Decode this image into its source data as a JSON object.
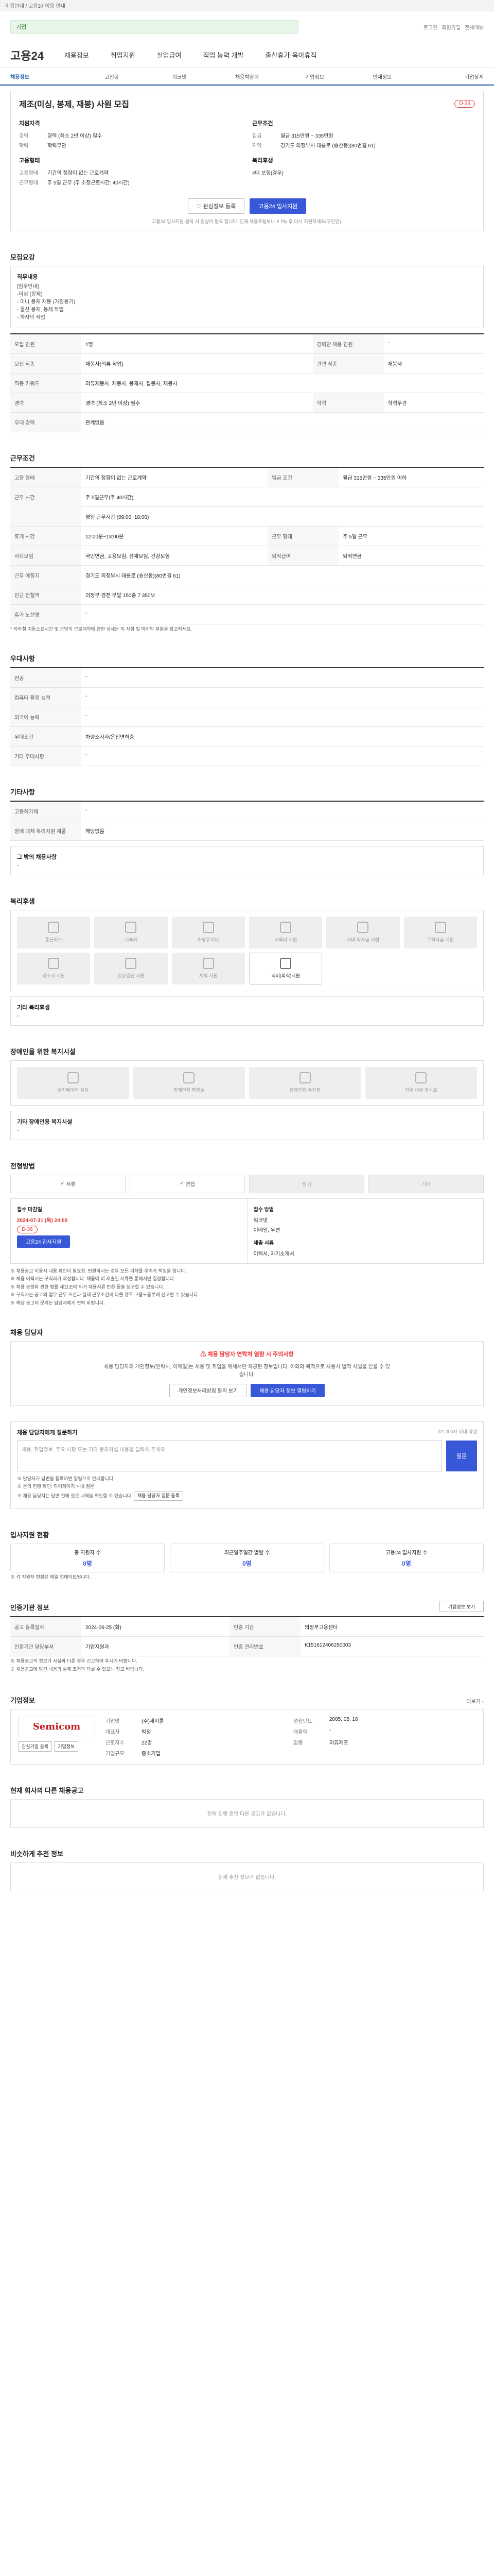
{
  "topbar": {
    "notice": "이용안내 / 고용24 이용 안내"
  },
  "search": {
    "value": "기업"
  },
  "util": [
    "로그인",
    "회원가입",
    "전체메뉴"
  ],
  "logo": "고용24",
  "gnb": [
    "채용정보",
    "취업지원",
    "실업급여",
    "직업 능력 개발",
    "출산휴가·육아휴직"
  ],
  "subnav": [
    "채용정보",
    "고진공",
    "워크넷",
    "채용박람회",
    "기업정보",
    "인재정보",
    "기업상세"
  ],
  "hero": {
    "title": "제조(미싱, 봉제, 재봉) 사원 모집",
    "dday": "D-36",
    "left_title": "지원자격",
    "right_title": "근무조건",
    "left": [
      {
        "k": "경력",
        "v": "경력 (최소 2년 이상) 필수"
      },
      {
        "k": "학력",
        "v": "학력무관"
      }
    ],
    "right": [
      {
        "k": "임금",
        "v": "월급 315만원 ~ 335만원"
      },
      {
        "k": "지역",
        "v": "경기도 의정부시 태릉로 (송산동)(80번길 61)"
      }
    ],
    "left2_title": "고용형태",
    "left2": [
      {
        "k": "고용형태",
        "v": "기간의 정함이 없는 근로계약"
      },
      {
        "k": "근무형태",
        "v": "주 5일 근무 (주 소정근로시간: 40시간)"
      }
    ],
    "right2_title": "복리후생",
    "right2": [
      {
        "k": "",
        "v": "4대 보험(경우)"
      }
    ],
    "btn_scrap": "관심정보 등록",
    "btn_apply": "고용24 입사지원",
    "note": "고용24 입사지원 클릭 시 원상이 필요 합니다. 인재 채용포털보나 X Pix 후 이시 지원하세요(구인인)."
  },
  "s_recruit": {
    "title": "모집요강",
    "duty_label": "직무내용",
    "duty": [
      "[임무안내]",
      "-미싱 (봉제)",
      "- 미니 봉재 재봉 (가정용기)",
      "- 물산 봉제, 봉제 작업",
      "- 하자의 직업"
    ],
    "rows": [
      [
        "모집 인원",
        "1명",
        "경력단 채용 인원",
        "-"
      ],
      [
        "모집 직종",
        "재봉사(의류 작업)",
        "관련 직종",
        "재봉사"
      ],
      [
        "직종 키워드",
        "의류재봉사, 재봉사, 봉제사, 절봉사, 재봉사",
        "",
        ""
      ],
      [
        "경력",
        "경력 (최소 2년 이상) 필수",
        "학력",
        "학력무관"
      ],
      [
        "우대 경력",
        "관계없음",
        "",
        ""
      ]
    ]
  },
  "s_cond": {
    "title": "근무조건",
    "rows": [
      [
        "고용 형태",
        "기간의 정함이 없는 근로계약",
        "임금 조건",
        "월급 315만원 ~ 335만원 이하"
      ],
      [
        "근무 시간",
        "주 5일근무(주 40시간)",
        "",
        ""
      ],
      [
        "근무 형태",
        "평일 근무시간 (09:00~18:00)",
        "",
        ""
      ],
      [
        "휴게 시간",
        "12:00분~13:00분",
        "근무 형태",
        "주 5일 근무"
      ],
      [
        "사회보험",
        "국민연금, 고용보험, 산재보험, 건강보험",
        "퇴직급여",
        "퇴직연금"
      ],
      [
        "근무 예정지",
        "경기도 의정부시 태릉로 (송산동)(80번길 61)",
        "",
        ""
      ],
      [
        "인근 전철역",
        "의정부 경전 부발 150종 7 350M",
        "",
        ""
      ],
      [
        "휴가 노선명",
        "-",
        "",
        ""
      ]
    ],
    "note": "* 지하철 이동소요시간 및 근방이 근로계약에 관한 상세는 지 사항 및 마지막 부분을 참고하세요."
  },
  "s_prefer": {
    "title": "우대사항",
    "rows": [
      [
        "전공",
        "-"
      ],
      [
        "컴퓨터 활용 능력",
        "-"
      ],
      [
        "외국어 능력",
        "-"
      ],
      [
        "우대조건",
        "차량소지자/운전면허증"
      ],
      [
        "기타 우대사항",
        "-"
      ]
    ]
  },
  "s_other": {
    "title": "기타사항",
    "rows": [
      [
        "고용허가제",
        "-"
      ],
      [
        "장애 대체 복리지원 제품",
        "해당없음"
      ]
    ],
    "sub_title": "그 밖의 채용사항",
    "sub_value": "-"
  },
  "s_benefit": {
    "title": "복리후생",
    "items": [
      "통근버스",
      "기숙사",
      "차량유지비",
      "교육비 지원",
      "자녀 학자금 지원",
      "주택자금 지원",
      "경조사 지원",
      "건강검진 지원",
      "체력 지원",
      "식비(회식)지원"
    ],
    "on_index": 9,
    "other_label": "기타 복리후생",
    "other_value": "-"
  },
  "s_disability": {
    "title": "장애인을 위한 복지시설",
    "items": [
      "엘리베이터 설치",
      "장애인용 화장실",
      "장애인용 주차장",
      "건물 내부 경사로"
    ],
    "other_label": "기타 장애인용 복지시설",
    "other_value": "-"
  },
  "s_process": {
    "title": "전형방법",
    "tabs": [
      "서류",
      "면접",
      "필기",
      "기타"
    ],
    "active_tabs": [
      0,
      1
    ],
    "deadline_label": "접수 마감일",
    "deadline": "2024-07-31 (목) 24:00",
    "dday": "D-36",
    "apply_btn": "고용24 입사지원",
    "method_label": "접수 방법",
    "method": "워크넷",
    "method_sub": "이메일, 우편",
    "docs_label": "제출 서류",
    "docs": "이력서, 자기소개서"
  },
  "s_process_notes": [
    "※ 채용공고 이용시 내용 확인이 필요함. 반환하시는 경우 모든 피해를 우리가 책임을 집니다.",
    "※ 채용 이력서는 구직자가 작성합니다. 채용에 미 제출된 서류를 통해서만 결정합니다.",
    "※ 채용 공정화 관한 법률 제11조에 의거 채용서류 반환 등을 청구할 수 있습니다.",
    "※ 구직자는 공고의 업무 근무 조건과 실제 근무조건이 다를 경우 고용노동부에 신고할 수 있습니다.",
    "※ 해당 공고의 문의는 담당자에게 연락 바랍니다."
  ],
  "s_contact": {
    "title": "채용 담당자",
    "warn_title": "채용 담당자 연락처 열람 시 주의사항",
    "warn_body": "채용 담당자의 개인정보(연락처, 이메일)는 채용 및 취업을 위해서만 제공된 정보입니다. 이외의 목적으로 사용시 법적 처벌을 받을 수 있습니다.",
    "btn_consent": "개인정보처리방침 동의 보기",
    "btn_view": "채용 담당자 정보 열람하기"
  },
  "s_qna": {
    "title": "채용 담당자에게 질문하기",
    "counter": "0/1,000자 이내 작성",
    "placeholder": "채용, 취업정보, 주요 사항 또는 기타 문의하실 내용을 입력해 주세요.",
    "btn": "질문",
    "notes": [
      "※ 담당자가 답변을 등록하면 알림으로 안내합니다.",
      "※ 문의 현황 확인: 마이페이지 > 내 질문",
      "※ 채용 담당자는 답변 전에 질문 내역을 확인할 수 있습니다."
    ],
    "note_btn": "채용 담당자 질문 등록"
  },
  "s_apply": {
    "title": "입사지원 현황",
    "stats": [
      {
        "label": "총 지원자 수",
        "value": "0명"
      },
      {
        "label": "최근일주일간 열람 수",
        "value": "0명"
      },
      {
        "label": "고용24 입사지원 수",
        "value": "0명"
      }
    ],
    "note": "※ 각 지원자 현황은 매일 업데이트됩니다."
  },
  "s_info": {
    "title": "인증기관 정보",
    "btn": "기업정보 보기",
    "rows": [
      [
        "공고 등록일자",
        "2024-06-25 (화)",
        "인증 기관",
        "의정부고용센터"
      ],
      [
        "인증기관 담당부서",
        "기업지원과",
        "인증 관리번호",
        "K151612406250003"
      ]
    ],
    "notes": [
      "※ 채용공고의 정보가 사실과 다른 경우 신고하여 주시기 바랍니다.",
      "※ 채용공고에 담긴 내용의 실제 조건과 다를 수 있으니 참고 바랍니다."
    ]
  },
  "s_company": {
    "title": "기업정보",
    "more": "더보기",
    "logo": "Semicom",
    "btn_a": "관심기업 등록",
    "btn_b": "기업정보",
    "fields": [
      [
        "기업명",
        "(주)세미콤",
        "설립년도",
        "2005. 05. 16"
      ],
      [
        "대표자",
        "박정",
        "매출액",
        "-"
      ],
      [
        "근로자수",
        "22명",
        "업종",
        "의류제조"
      ],
      [
        "기업규모",
        "중소기업",
        "",
        ""
      ]
    ]
  },
  "s_more": {
    "title": "현재 회사의 다른 채용공고",
    "empty": "현재 진행 중인 다른 공고가 없습니다."
  },
  "s_reco": {
    "title": "비슷하게 추천 정보",
    "empty": "현재 추천 정보가 없습니다."
  }
}
